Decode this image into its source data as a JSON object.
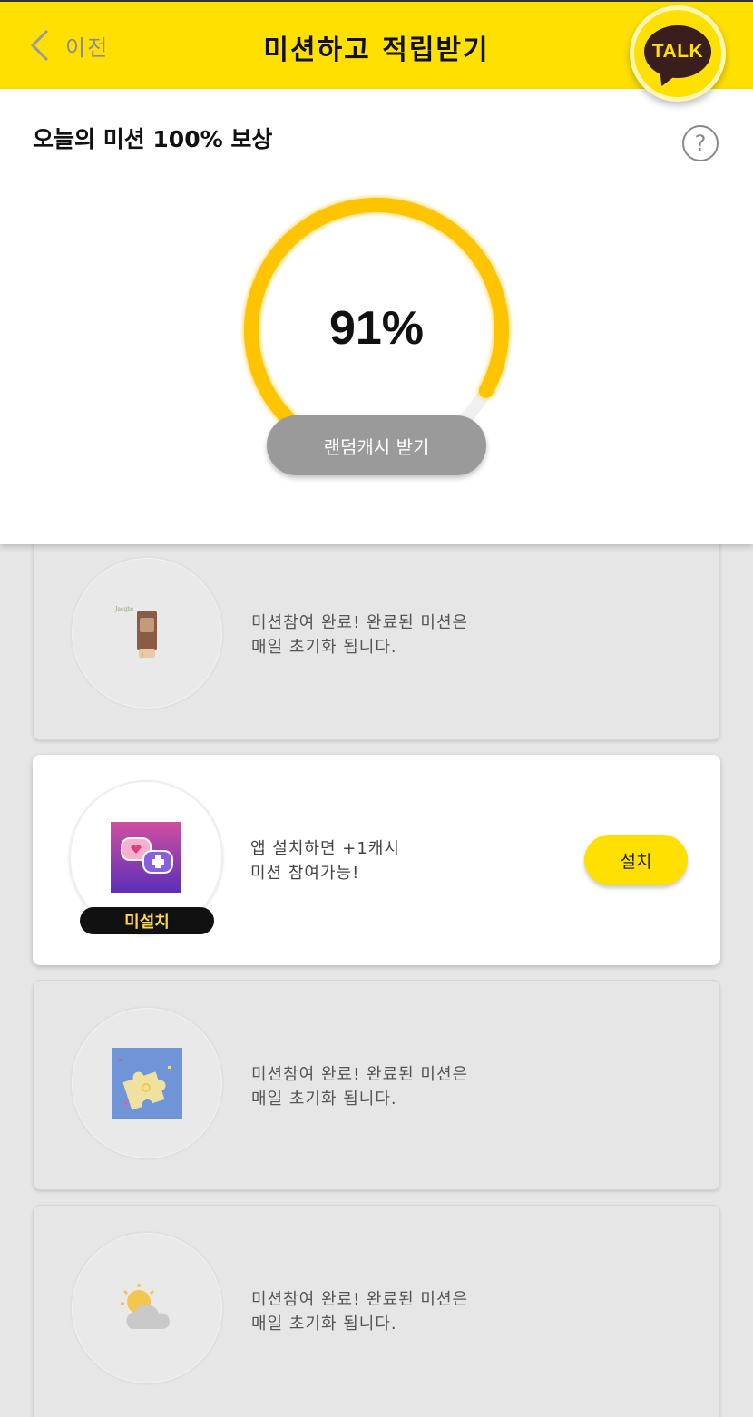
{
  "header": {
    "back_label": "이전",
    "title": "미션하고 적립받기",
    "talk_label": "TALK",
    "brand_color": "#ffe000"
  },
  "reward": {
    "title": "오늘의 미션 100% 보상",
    "help_icon": "question-circle-icon",
    "progress_percent": 91,
    "progress_label": "91%",
    "button_label": "랜덤캐시 받기"
  },
  "missions": [
    {
      "state": "completed",
      "icon": "cosmetic-tube-icon",
      "text_line1": "미션참여 완료! 완료된 미션은",
      "text_line2": "매일 초기화 됩니다."
    },
    {
      "state": "available",
      "icon": "chat-heart-plus-app-icon",
      "badge": "미설치",
      "text_line1": "앱 설치하면 +1캐시",
      "text_line2": "미션 참여가능!",
      "button_label": "설치"
    },
    {
      "state": "completed",
      "icon": "puzzle-piece-icon",
      "text_line1": "미션참여 완료! 완료된 미션은",
      "text_line2": "매일 초기화 됩니다."
    },
    {
      "state": "completed",
      "icon": "sun-cloud-icon",
      "text_line1": "미션참여 완료! 완료된 미션은",
      "text_line2": "매일 초기화 됩니다."
    }
  ]
}
